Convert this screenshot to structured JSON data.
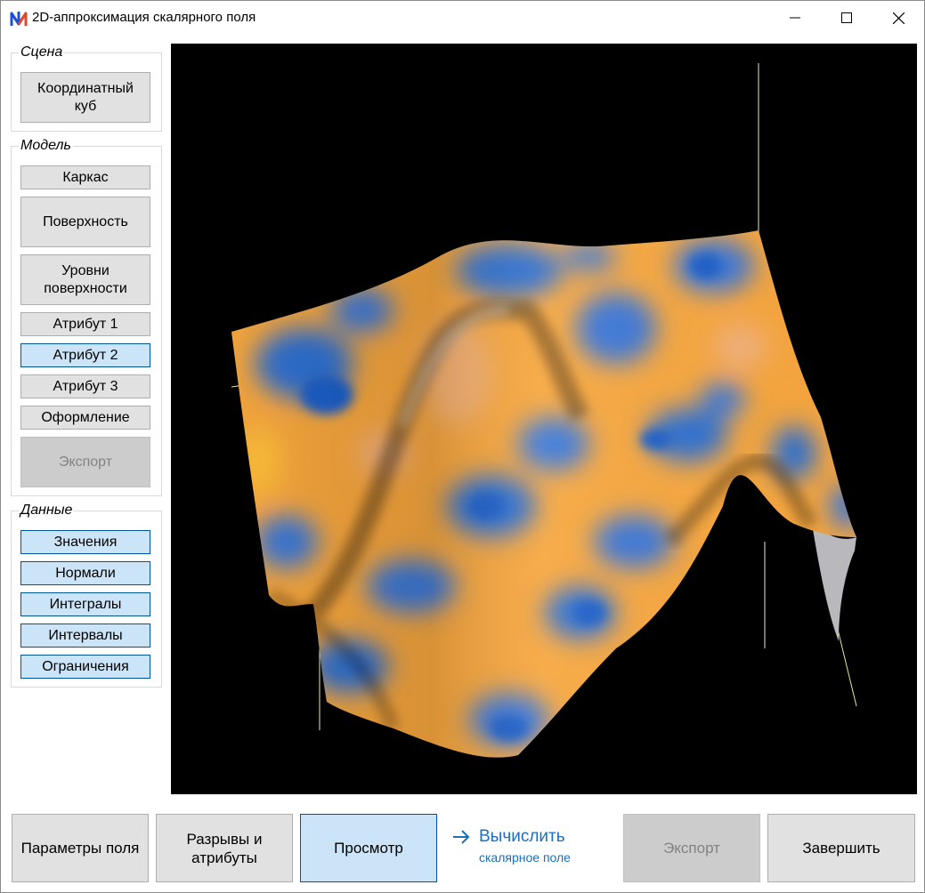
{
  "window": {
    "title": "2D-аппроксимация скалярного поля",
    "icon": "app-logo-icon"
  },
  "sidebar": {
    "scene": {
      "label": "Сцена",
      "buttons": [
        {
          "label": "Координатный\nкуб"
        }
      ]
    },
    "model": {
      "label": "Модель",
      "buttons": [
        {
          "label": "Каркас"
        },
        {
          "label": "Поверхность"
        },
        {
          "label": "Уровни\nповерхности"
        },
        {
          "label": "Атрибут 1"
        },
        {
          "label": "Атрибут 2"
        },
        {
          "label": "Атрибут 3"
        },
        {
          "label": "Оформление"
        },
        {
          "label": "Экспорт"
        }
      ]
    },
    "data": {
      "label": "Данные",
      "buttons": [
        {
          "label": "Значения"
        },
        {
          "label": "Нормали"
        },
        {
          "label": "Интегралы"
        },
        {
          "label": "Интервалы"
        },
        {
          "label": "Ограничения"
        }
      ]
    }
  },
  "footer": {
    "field_params": "Параметры поля",
    "breaks": "Разрывы и\nатрибуты",
    "view": "Просмотр",
    "compute_main": "Вычислить",
    "compute_sub": "скалярное поле",
    "export": "Экспорт",
    "finish": "Завершить"
  },
  "colors": {
    "accent": "#1a6fbf",
    "selected_button": "#cce4f7",
    "surface_orange": "#f7a63d",
    "surface_blue": "#2f6fd0",
    "viewport_bg": "#000000"
  }
}
